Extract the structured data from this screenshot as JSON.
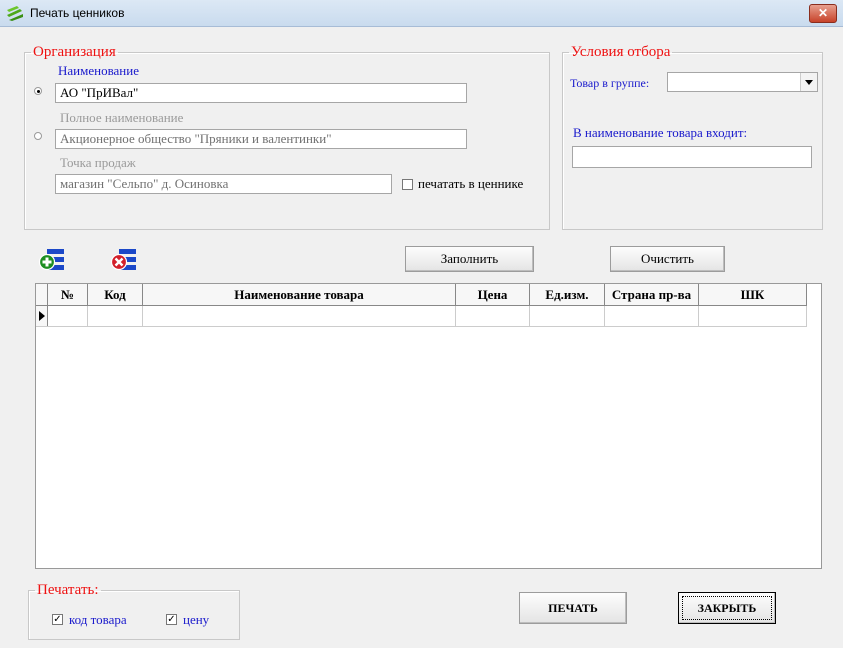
{
  "window": {
    "title": "Печать ценников",
    "close_label": "✕"
  },
  "organization": {
    "legend": "Организация",
    "name_label": "Наименование",
    "name_value": "АО \"ПрИВал\"",
    "full_name_label": "Полное наименование",
    "full_name_value": "Акционерное общество \"Пряники и валентинки\"",
    "point_label": "Точка продаж",
    "point_value": "магазин \"Сельпо\" д. Осиновка",
    "print_in_tag_label": "печатать в ценнике",
    "selected_option": "name"
  },
  "filter": {
    "legend": "Условия отбора",
    "group_label": "Товар в группе:",
    "group_value": "",
    "contains_label": "В наименование товара входит:",
    "contains_value": ""
  },
  "toolbar": {
    "add_icon": "add-list-icon",
    "remove_icon": "remove-list-icon",
    "fill_label": "Заполнить",
    "clear_label": "Очистить"
  },
  "table": {
    "columns": [
      "№",
      "Код",
      "Наименование товара",
      "Цена",
      "Ед.изм.",
      "Страна пр-ва",
      "ШК"
    ],
    "rows": [
      [
        "",
        "",
        "",
        "",
        "",
        "",
        ""
      ]
    ]
  },
  "print_options": {
    "legend": "Печатать:",
    "code_label": "код товара",
    "price_label": "цену",
    "code_checked": true,
    "price_checked": true
  },
  "actions": {
    "print_label": "ПЕЧАТЬ",
    "close_label": "ЗАКРЫТЬ"
  },
  "colors": {
    "legend_red": "#ee1111",
    "label_blue": "#1a1acc"
  }
}
